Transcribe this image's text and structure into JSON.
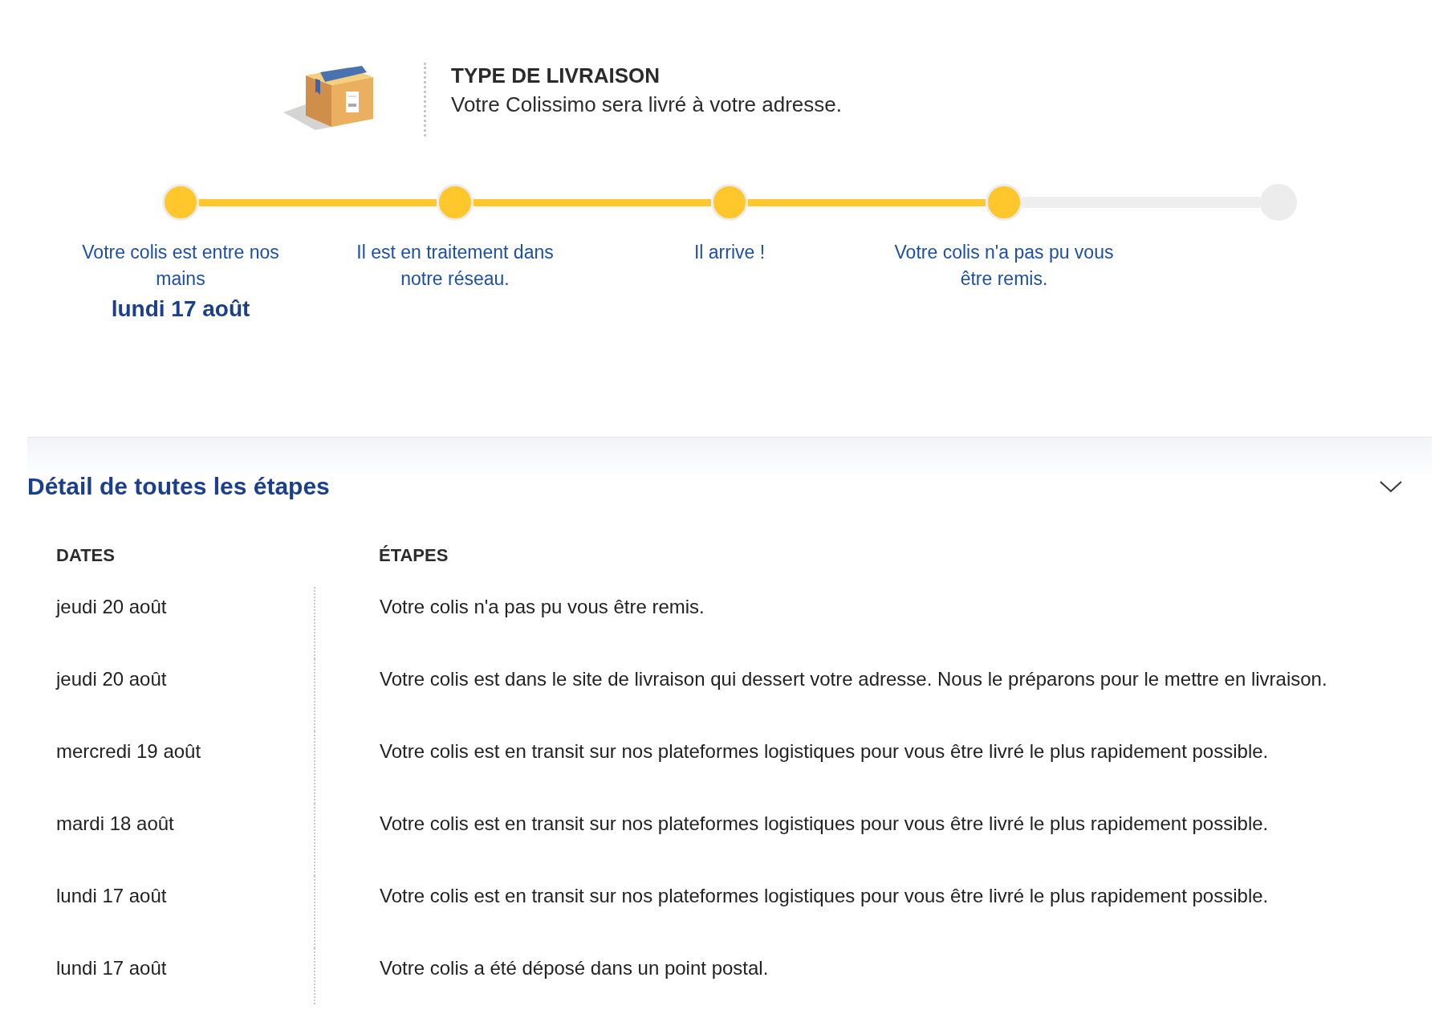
{
  "delivery": {
    "title": "TYPE DE LIVRAISON",
    "description": "Votre Colissimo sera livré à votre adresse."
  },
  "progress": {
    "steps": [
      {
        "label": "Votre colis est entre nos mains",
        "date": "lundi 17 août",
        "done": true
      },
      {
        "label": "Il est en traitement dans notre réseau.",
        "done": true
      },
      {
        "label": "Il arrive !",
        "done": true
      },
      {
        "label": "Votre colis n'a pas pu vous être remis.",
        "done": true
      },
      {
        "done": false
      }
    ]
  },
  "details": {
    "title": "Détail de toutes les étapes",
    "expanded": true,
    "columns": [
      "DATES",
      "ÉTAPES"
    ],
    "rows": [
      {
        "date": "jeudi 20 août",
        "step": "Votre colis n'a pas pu vous être remis."
      },
      {
        "date": "jeudi 20 août",
        "step": "Votre colis est dans le site de livraison qui dessert votre adresse. Nous le préparons pour le mettre en livraison."
      },
      {
        "date": "mercredi 19 août",
        "step": "Votre colis est en transit sur nos plateformes logistiques pour vous être livré le plus rapidement possible."
      },
      {
        "date": "mardi 18 août",
        "step": "Votre colis est en transit sur nos plateformes logistiques pour vous être livré le plus rapidement possible."
      },
      {
        "date": "lundi 17 août",
        "step": "Votre colis est en transit sur nos plateformes logistiques pour vous être livré le plus rapidement possible."
      },
      {
        "date": "lundi 17 août",
        "step": "Votre colis a été déposé dans un point postal."
      }
    ]
  }
}
